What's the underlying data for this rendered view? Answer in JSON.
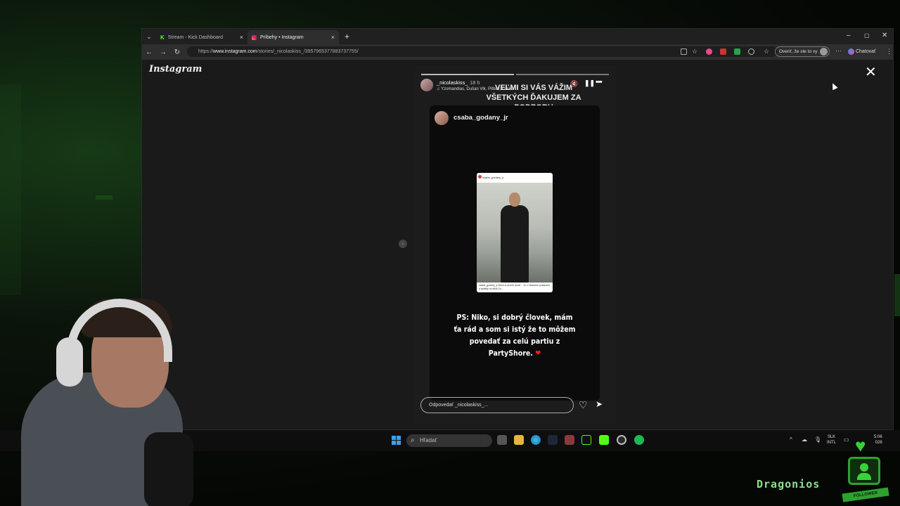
{
  "browser": {
    "tabs": [
      {
        "label": "Stream - Kick Dashboard",
        "icon": "kick-icon"
      },
      {
        "label": "Príbehy • Instagram",
        "icon": "instagram-icon"
      }
    ],
    "url_prefix": "https://",
    "url_host": "www.instagram.com",
    "url_path": "/stories/_nicolaskiss_/3957965377883737755/",
    "verify_button": "Overiť, že ste to vy",
    "chat_button": "Chatovať"
  },
  "instagram": {
    "logo": "Instagram",
    "story": {
      "username": "_nicolaskiss_",
      "time": "18 h",
      "music": "Yzomandias, Dušan Vlk, Pitbull, Lanko",
      "overlay_text": "VEĽMI SI VÁS VÁŽIM VŠETKÝCH ĎAKUJEM ZA PODPORU",
      "shared_username": "csaba_godany_jr",
      "post_mini_user": "csaba_godany_jr",
      "post_caption": "csaba_godany_jr Boris to jemně dovie... Je v úžasném postavení a splatitý mi dlžíš Zo...",
      "ps_text": "PS: Niko, si dobrý človek, mám ťa rád a som si istý že to môžem povedať za celú partiu z PartyShore.",
      "ps_heart": "❤",
      "reply_placeholder": "Odpovedať _nicolaskiss_..."
    }
  },
  "taskbar": {
    "search_placeholder": "Hľadať",
    "lang_top": "SLK",
    "lang_bottom": "INTL",
    "clock_time": "5:06",
    "clock_date": "026"
  },
  "overlay": {
    "streamer_name": "Dragonios",
    "follower_label": "FOLLOWER"
  },
  "colors": {
    "accent_green": "#2ea12e",
    "instagram_heart": "#e22222",
    "windows_blue": "#3aa0f0"
  }
}
